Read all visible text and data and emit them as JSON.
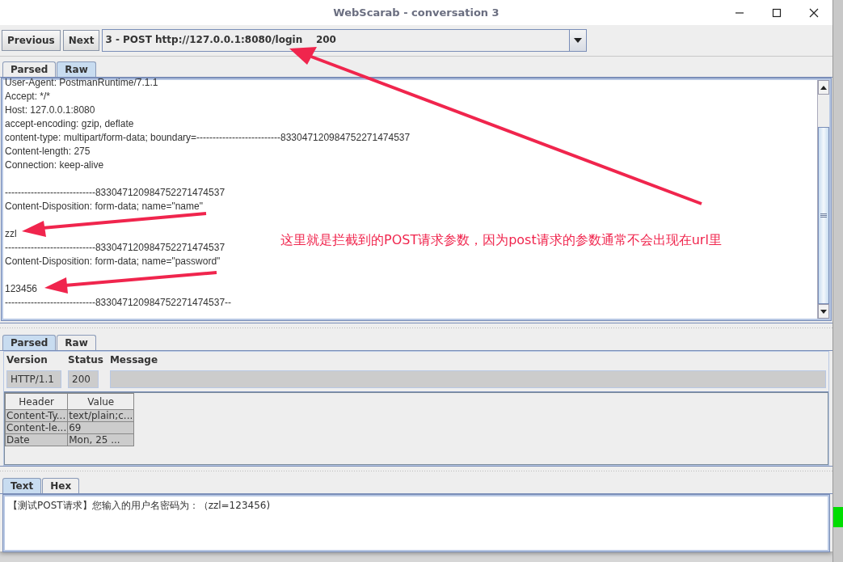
{
  "window": {
    "title": "WebScarab - conversation 3"
  },
  "navigation": {
    "buttons": [
      {
        "label": "Previous"
      },
      {
        "label": "Next"
      }
    ],
    "conversation_selector": {
      "value": "3 - POST http://127.0.0.1:8080/login    200"
    }
  },
  "request": {
    "tabs": [
      {
        "label": "Parsed",
        "selected": false
      },
      {
        "label": "Raw",
        "selected": true
      }
    ],
    "raw_text": "User-Agent: PostmanRuntime/7.1.1\nAccept: */*\nHost: 127.0.0.1:8080\naccept-encoding: gzip, deflate\ncontent-type: multipart/form-data; boundary=--------------------------833047120984752271474537\nContent-length: 275\nConnection: keep-alive\n\n----------------------------833047120984752271474537\nContent-Disposition: form-data; name=\"name\"\n\nzzl\n----------------------------833047120984752271474537\nContent-Disposition: form-data; name=\"password\"\n\n123456\n----------------------------833047120984752271474537--"
  },
  "response": {
    "tabs": [
      {
        "label": "Parsed",
        "selected": true
      },
      {
        "label": "Raw",
        "selected": false
      }
    ],
    "fields": [
      {
        "label": "Version",
        "value": "HTTP/1.1"
      },
      {
        "label": "Status",
        "value": "200"
      },
      {
        "label": "Message"
      }
    ],
    "headers": {
      "columns": [
        "Header",
        "Value"
      ],
      "rows": [
        [
          "Content-Ty...",
          "text/plain;c..."
        ],
        [
          "Content-le...",
          "69"
        ],
        [
          "Date",
          "Mon, 25 ..."
        ]
      ]
    },
    "body_tabs": [
      {
        "label": "Text",
        "selected": true
      },
      {
        "label": "Hex",
        "selected": false
      }
    ],
    "body_text": "【测试POST请求】您输入的用户名密码为：（zzl=123456)"
  },
  "annotation": {
    "note": "这里就是拦截到的POST请求参数，因为post请求的参数通常不会出现在url里"
  }
}
